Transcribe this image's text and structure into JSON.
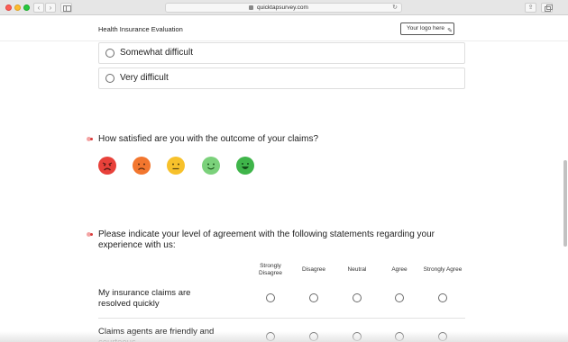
{
  "browser": {
    "url": "quicktapsurvey.com"
  },
  "header": {
    "title": "Health Insurance Evaluation",
    "logo_placeholder": "Your logo here"
  },
  "previous_question": {
    "options": [
      "Somewhat difficult",
      "Very difficult"
    ]
  },
  "satisfaction_question": {
    "text": "How satisfied are you with the outcome of your claims?",
    "faces": [
      {
        "icon": "very-dissatisfied-face-icon",
        "color": "#e8413a"
      },
      {
        "icon": "dissatisfied-face-icon",
        "color": "#f2762e"
      },
      {
        "icon": "neutral-face-icon",
        "color": "#f7c12b"
      },
      {
        "icon": "satisfied-face-icon",
        "color": "#7bd17b"
      },
      {
        "icon": "very-satisfied-face-icon",
        "color": "#3fb54a"
      }
    ]
  },
  "agreement_question": {
    "text_line1": "Please indicate your level of agreement with the following statements regarding your",
    "text_line2": "experience with us:",
    "columns": [
      "Strongly Disagree",
      "Disagree",
      "Neutral",
      "Agree",
      "Strongly Agree"
    ],
    "column_lines": [
      [
        "Strongly",
        "Disagree"
      ],
      [
        "Disagree"
      ],
      [
        "Neutral"
      ],
      [
        "Agree"
      ],
      [
        "Strongly Agree"
      ]
    ],
    "rows": [
      {
        "line1": "My insurance claims are",
        "line2": "resolved quickly"
      },
      {
        "line1": "Claims agents are friendly and",
        "line2": "courteous"
      }
    ]
  }
}
